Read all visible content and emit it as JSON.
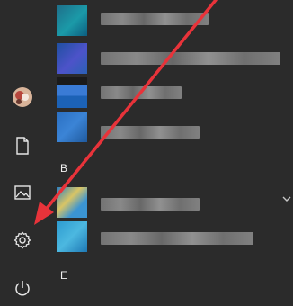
{
  "rail": {
    "avatar_icon": "user-avatar",
    "items": [
      {
        "icon": "document-icon"
      },
      {
        "icon": "pictures-icon"
      },
      {
        "icon": "gear-icon"
      },
      {
        "icon": "power-icon"
      }
    ]
  },
  "app_list": {
    "group_letters": [
      "B",
      "E"
    ],
    "expand_icon": "chevron-down-icon"
  },
  "annotation": {
    "type": "arrow",
    "color": "#e8333a"
  },
  "colors": {
    "background": "#2b2b2b",
    "text": "#f0f0f0",
    "arrow": "#e8333a"
  }
}
